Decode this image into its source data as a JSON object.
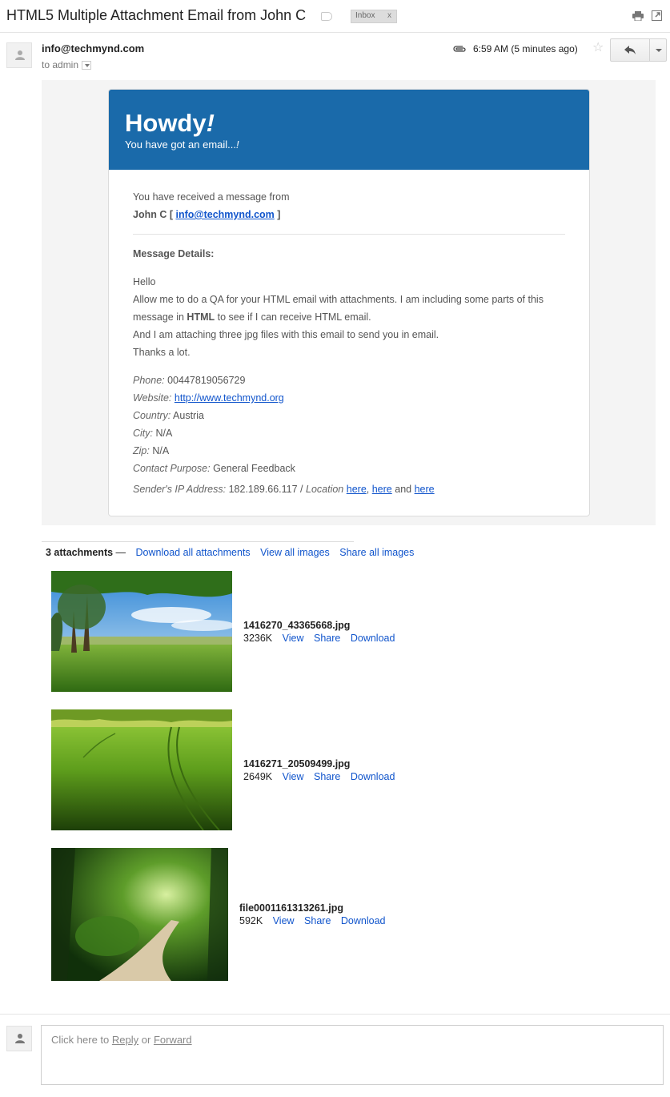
{
  "subject": "HTML5 Multiple Attachment Email from John C",
  "label": {
    "name": "Inbox",
    "remove": "x"
  },
  "sender": {
    "email": "info@techmynd.com",
    "to_line": "to admin"
  },
  "timestamp": "6:59 AM (5 minutes ago)",
  "email": {
    "greeting": "Howdy",
    "greeting_mark": "!",
    "subheading": "You have got an email...",
    "subheading_mark": "!",
    "received_intro": "You have received a message from",
    "from_name": "John C [",
    "from_email": "info@techmynd.com",
    "from_close": "]",
    "details_heading": "Message Details:",
    "message_lines": {
      "l1": "Hello",
      "l2": "Allow me to do a QA for your HTML email with attachments. I am including some parts of this",
      "l3_pre": "message in",
      "l3_bold": "HTML",
      "l3_post": "to see if I can receive HTML email.",
      "l4": "And I am attaching three jpg files with this email to send you in email.",
      "l5": "Thanks a lot."
    },
    "fields": {
      "phone_label": "Phone:",
      "phone": "00447819056729",
      "website_label": "Website:",
      "website": "http://www.techmynd.org",
      "country_label": "Country:",
      "country": "Austria",
      "city_label": "City:",
      "city": "N/A",
      "zip_label": "Zip:",
      "zip": "N/A",
      "purpose_label": "Contact Purpose:",
      "purpose": "General Feedback",
      "ip_label": "Sender's IP Address:",
      "ip": "182.189.66.117 /",
      "location_label": "Location",
      "here1": "here",
      "here2": "here",
      "and_text": "and",
      "here3": "here"
    }
  },
  "attachments": {
    "count_label": "3 attachments",
    "dash": "—",
    "download_all": "Download all attachments",
    "view_all": "View all images",
    "share_all": "Share all images",
    "files": [
      {
        "name": "1416270_43365668.jpg",
        "size": "3236K",
        "view": "View",
        "share": "Share",
        "download": "Download"
      },
      {
        "name": "1416271_20509499.jpg",
        "size": "2649K",
        "view": "View",
        "share": "Share",
        "download": "Download"
      },
      {
        "name": "file0001161313261.jpg",
        "size": "592K",
        "view": "View",
        "share": "Share",
        "download": "Download"
      }
    ]
  },
  "reply_box": {
    "prefix": "Click here to",
    "reply": "Reply",
    "or": "or",
    "forward": "Forward"
  },
  "colors": {
    "header_blue": "#1a6aaa",
    "link": "#1155cc"
  }
}
